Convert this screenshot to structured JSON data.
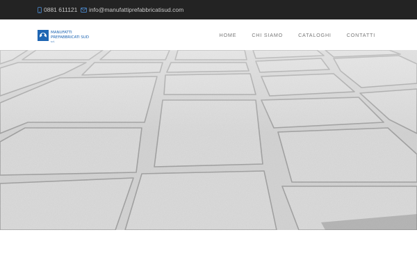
{
  "topbar": {
    "phone": "0881 611121",
    "email": "info@manufattiprefabbricatisud.com"
  },
  "logo": {
    "line1": "MANUFATTI",
    "line2": "PREFABBRICATI SUD",
    "suffix": "s.r.l."
  },
  "nav": {
    "items": [
      "HOME",
      "CHI SIAMO",
      "CATALOGHI",
      "CONTATTI"
    ]
  },
  "colors": {
    "topbar_bg": "#232323",
    "brand": "#1f66b3",
    "nav_text": "#777777"
  },
  "icons": {
    "phone": "phone-icon",
    "email": "envelope-icon"
  },
  "hero": {
    "subject": "paving-stones-photo"
  }
}
